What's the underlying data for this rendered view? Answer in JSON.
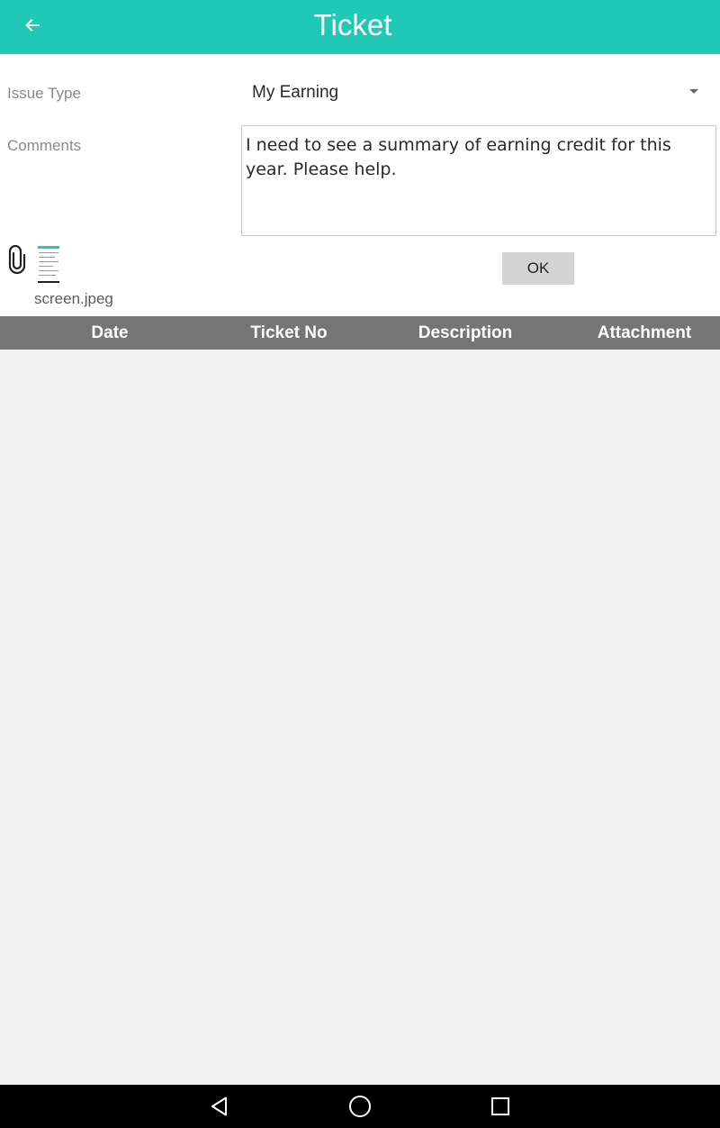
{
  "app_bar": {
    "title": "Ticket",
    "back_icon": "arrow-left-icon",
    "color": "#20c9b5"
  },
  "form": {
    "issue_type_label": "Issue Type",
    "issue_type_value": "My Earning",
    "comments_label": "Comments",
    "comments_value": "I need to see a summary of earning credit for this year. Please help.",
    "attachment_icon": "paperclip-icon",
    "attachment_file_name": "screen.jpeg",
    "ok_label": "OK"
  },
  "table": {
    "columns": [
      "Date",
      "Ticket No",
      "Description",
      "Attachment"
    ],
    "rows": []
  },
  "nav_bar": {
    "back_icon": "triangle-back-icon",
    "home_icon": "circle-home-icon",
    "recents_icon": "square-recents-icon"
  }
}
